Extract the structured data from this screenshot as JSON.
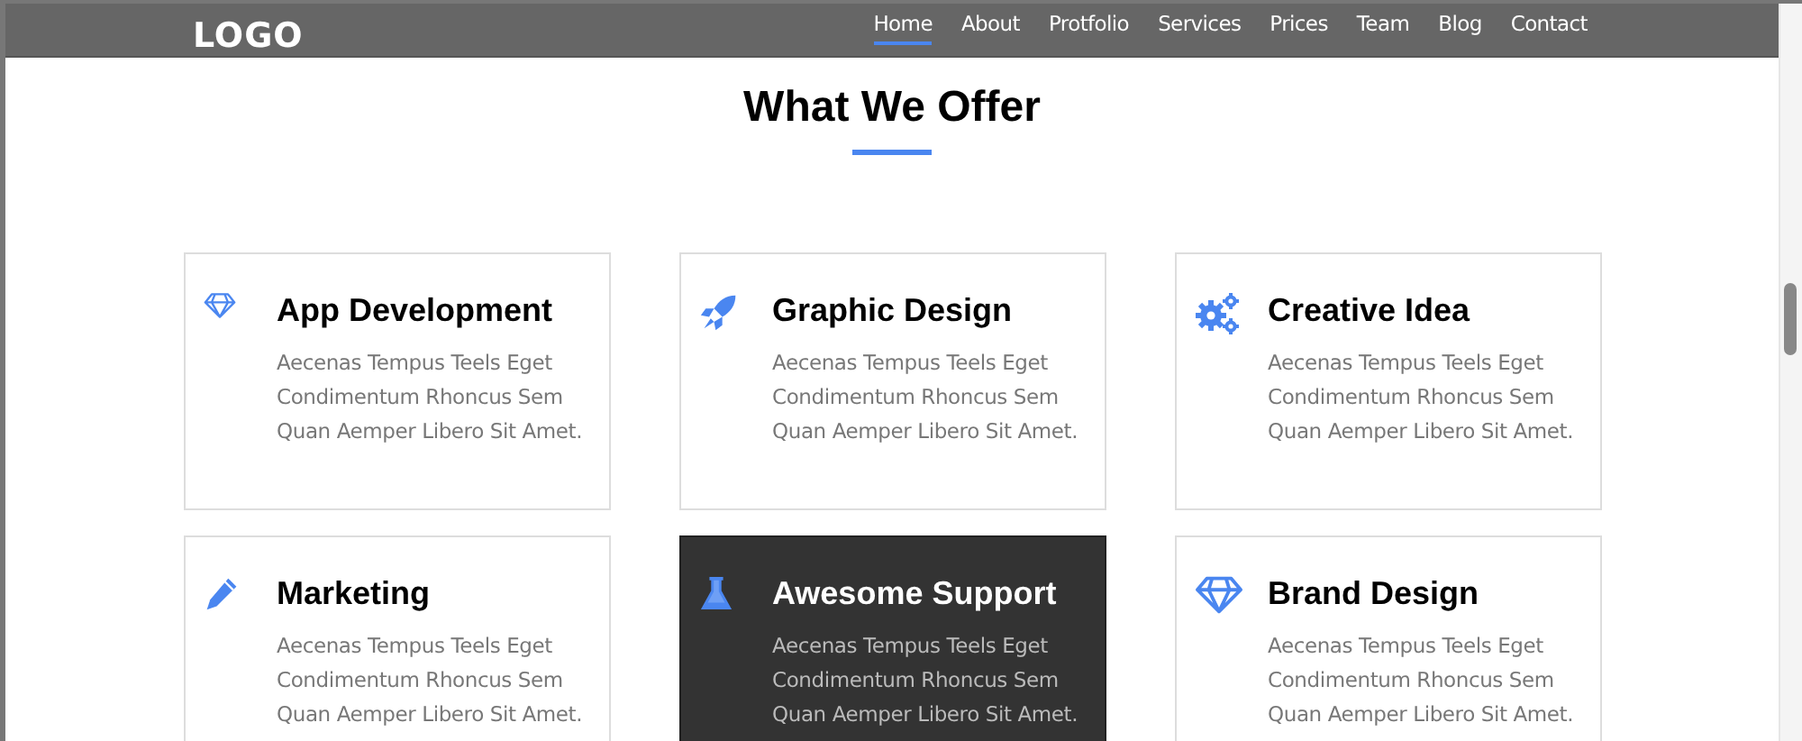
{
  "header": {
    "logo": "LOGO",
    "nav": [
      {
        "label": "Home",
        "selected": true
      },
      {
        "label": "About",
        "selected": false
      },
      {
        "label": "Protfolio",
        "selected": false
      },
      {
        "label": "Services",
        "selected": false
      },
      {
        "label": "Prices",
        "selected": false
      },
      {
        "label": "Team",
        "selected": false
      },
      {
        "label": "Blog",
        "selected": false
      },
      {
        "label": "Contact",
        "selected": false
      }
    ]
  },
  "section": {
    "title": "What We Offer",
    "services": [
      {
        "title": "App Development",
        "description": "Aecenas Tempus Teels Eget Condimentum Rhoncus Sem Quan Aemper Libero Sit Amet.",
        "highlighted": false
      },
      {
        "title": "Graphic Design",
        "description": "Aecenas Tempus Teels Eget Condimentum Rhoncus Sem Quan Aemper Libero Sit Amet.",
        "highlighted": false
      },
      {
        "title": "Creative Idea",
        "description": "Aecenas Tempus Teels Eget Condimentum Rhoncus Sem Quan Aemper Libero Sit Amet.",
        "highlighted": false
      },
      {
        "title": "Marketing",
        "description": "Aecenas Tempus Teels Eget Condimentum Rhoncus Sem Quan Aemper Libero Sit Amet.",
        "highlighted": false
      },
      {
        "title": "Awesome Support",
        "description": "Aecenas Tempus Teels Eget Condimentum Rhoncus Sem Quan Aemper Libero Sit Amet.",
        "highlighted": true
      },
      {
        "title": "Brand Design",
        "description": "Aecenas Tempus Teels Eget Condimentum Rhoncus Sem Quan Aemper Libero Sit Amet.",
        "highlighted": false
      }
    ]
  }
}
